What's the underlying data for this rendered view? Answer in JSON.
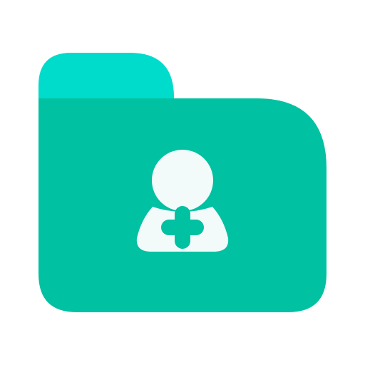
{
  "icon": {
    "name": "folder-add-user-icon",
    "colors": {
      "folder_tab": "#00DCCB",
      "folder_body": "#00C1A2",
      "user_glyph": "#F2FAFA",
      "plus_glyph": "#00C1A2",
      "background": "#FFFFFF"
    }
  }
}
